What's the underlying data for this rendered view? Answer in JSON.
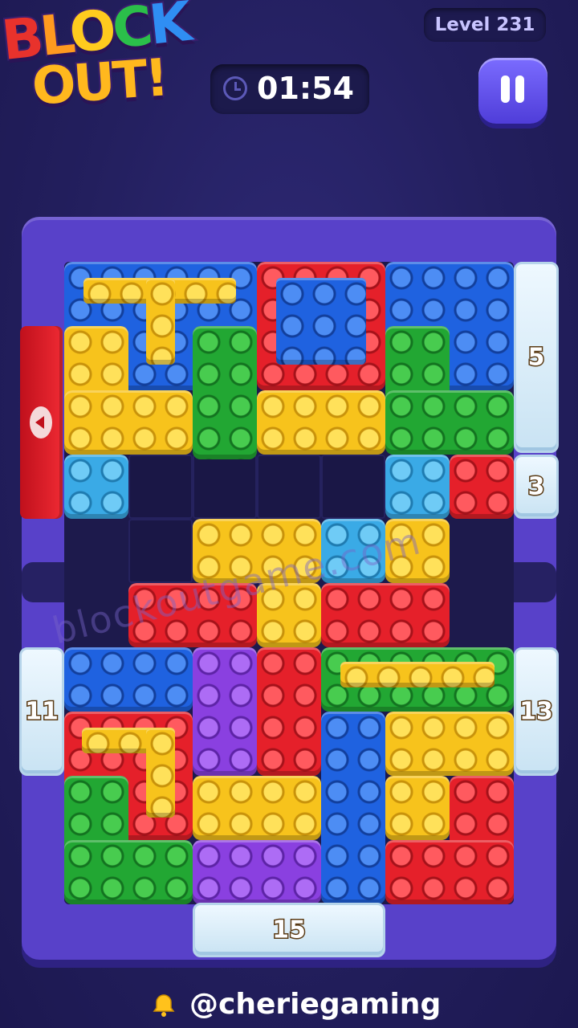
{
  "logo": {
    "line1": "BLOCK",
    "line2": "OUT!"
  },
  "header": {
    "level": "Level 231",
    "timer": "01:54"
  },
  "icons": {
    "clock": "clock-icon",
    "pause": "pause-icon",
    "exit_arrow": "arrow-left-icon",
    "bell": "bell-icon"
  },
  "gates": {
    "right_top": "5",
    "right_small": "3",
    "left_middle": "11",
    "right_middle": "13",
    "bottom": "15"
  },
  "watermark": "blockoutgame.com",
  "footer": {
    "handle": "@cheriegaming"
  },
  "colors": {
    "yellow": "#f7c31c",
    "red": "#e5202a",
    "blue": "#1f62e0",
    "green": "#22a733",
    "cyan": "#3aaae6",
    "purple": "#8a40e0",
    "frame": "#5841c9",
    "background": "#231f5e"
  }
}
